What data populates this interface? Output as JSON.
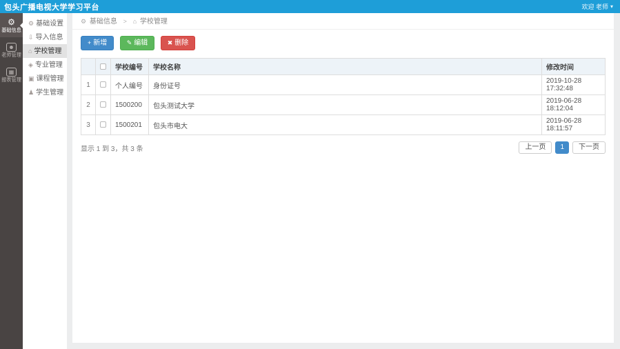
{
  "colors": {
    "navbar_bg": "#1e9ed8",
    "rail_bg": "#494443",
    "page_bg": "#ecedee",
    "primary": "#428bca",
    "success": "#5cb85c",
    "danger": "#d9534f",
    "table_header_bg": "#edf3f8"
  },
  "navbar": {
    "title": "包头广播电视大学学习平台",
    "user_label": "欢迎 老师",
    "caret": "▾"
  },
  "rail": {
    "items": [
      {
        "label": "基础信息",
        "icon": "⚙",
        "active": true
      },
      {
        "label": "老师管理",
        "icon": "☻",
        "active": false
      },
      {
        "label": "报表管理",
        "icon": "▦",
        "active": false
      }
    ]
  },
  "submenu": {
    "items": [
      {
        "label": "基础设置",
        "icon": "⚙",
        "active": false
      },
      {
        "label": "导入信息",
        "icon": "⇩",
        "active": false
      },
      {
        "label": "学校管理",
        "icon": "⌂",
        "active": true
      },
      {
        "label": "专业管理",
        "icon": "◈",
        "active": false
      },
      {
        "label": "课程管理",
        "icon": "▣",
        "active": false
      },
      {
        "label": "学生管理",
        "icon": "♟",
        "active": false
      }
    ]
  },
  "breadcrumb": {
    "parent_icon": "⚙",
    "parent": "基础信息",
    "separator": ">",
    "current_icon": "⌂",
    "current": "学校管理"
  },
  "toolbar": {
    "add": {
      "icon": "+",
      "label": "新增"
    },
    "edit": {
      "icon": "✎",
      "label": "编辑"
    },
    "delete": {
      "icon": "✖",
      "label": "删除"
    }
  },
  "table": {
    "headers": {
      "code": "学校编号",
      "name": "学校名称",
      "time": "修改时间"
    },
    "rows": [
      {
        "index": "1",
        "code": "个人编号",
        "name": "身份证号",
        "time": "2019-10-28 17:32:48"
      },
      {
        "index": "2",
        "code": "1500200",
        "name": "包头测试大学",
        "time": "2019-06-28 18:12:04"
      },
      {
        "index": "3",
        "code": "1500201",
        "name": "包头市电大",
        "time": "2019-06-28 18:11:57"
      }
    ]
  },
  "footer": {
    "summary": "显示 1 到 3，共 3 条",
    "prev": "上一页",
    "page": "1",
    "next": "下一页"
  }
}
